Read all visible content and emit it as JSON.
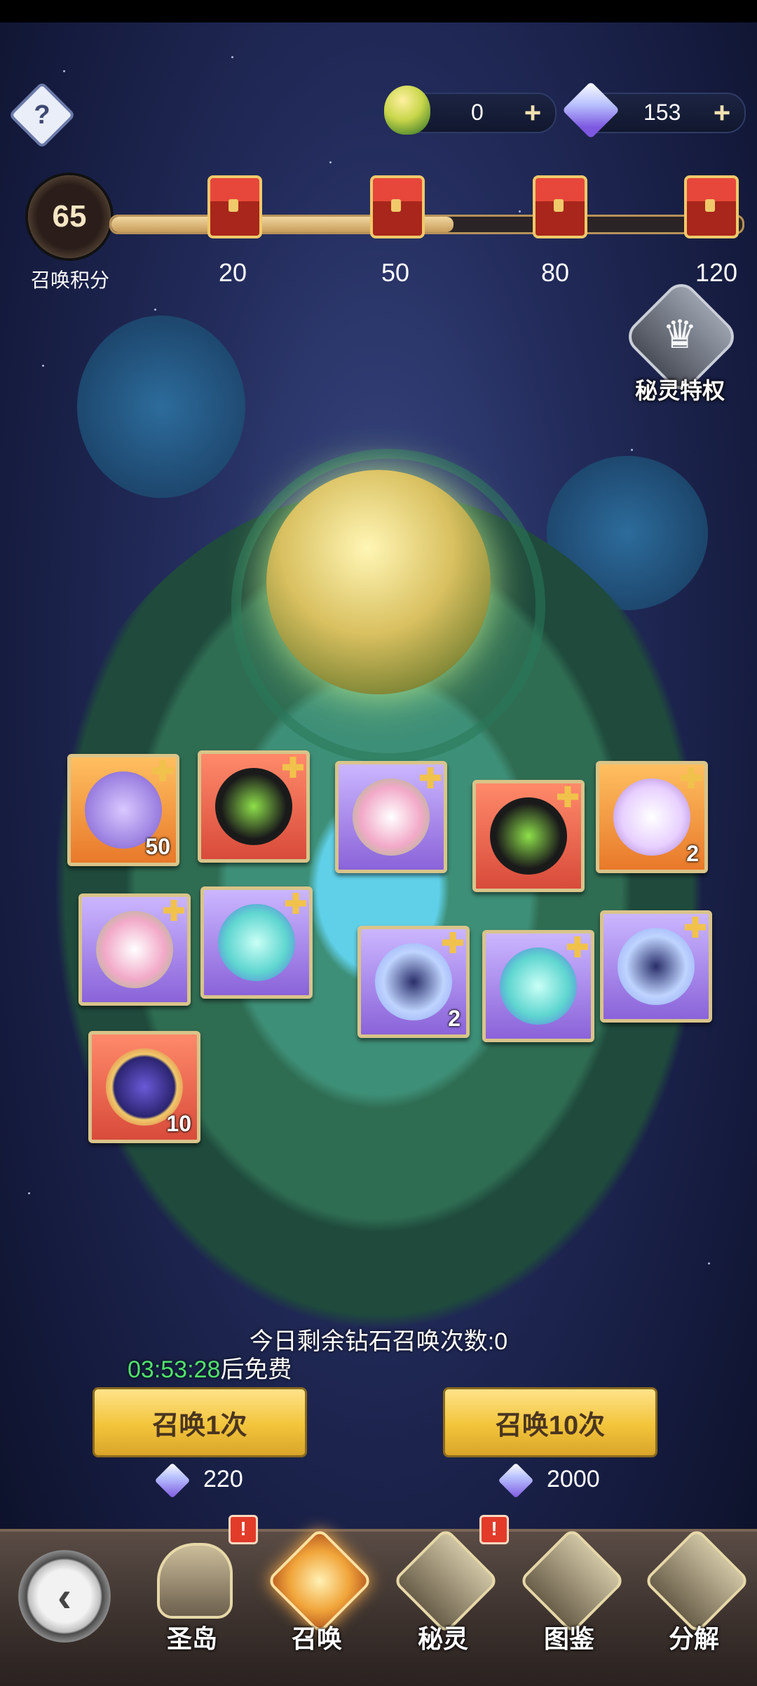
{
  "top_bar": {
    "help_icon": "help-icon",
    "currencies": [
      {
        "name": "leaf-token",
        "value": "0",
        "icon": "leaf-egg-icon"
      },
      {
        "name": "diamond",
        "value": "153",
        "icon": "diamond-icon"
      }
    ],
    "plus_label": "+"
  },
  "progress": {
    "current_score": "65",
    "score_label": "召唤积分",
    "current_value": 65,
    "milestones": [
      {
        "value": "20",
        "icon": "chest-icon"
      },
      {
        "value": "50",
        "icon": "chest-icon"
      },
      {
        "value": "80",
        "icon": "locked-chest-icon"
      },
      {
        "value": "120",
        "icon": "locked-chest-icon"
      }
    ]
  },
  "privilege": {
    "label": "秘灵特权",
    "icon": "crown-icon"
  },
  "rewards": [
    {
      "name": "dragon-unicorn",
      "count": "50",
      "rarity": "orange"
    },
    {
      "name": "dark-rabbit",
      "count": "",
      "rarity": "red"
    },
    {
      "name": "flower-sprite",
      "count": "",
      "rarity": "purple"
    },
    {
      "name": "dark-rabbit",
      "count": "",
      "rarity": "red"
    },
    {
      "name": "white-cat",
      "count": "2",
      "rarity": "orange"
    },
    {
      "name": "flower-sprite",
      "count": "",
      "rarity": "purple"
    },
    {
      "name": "ghost-deer",
      "count": "",
      "rarity": "purple"
    },
    {
      "name": "cloud-bunny",
      "count": "2",
      "rarity": "purple"
    },
    {
      "name": "ghost-deer",
      "count": "",
      "rarity": "purple"
    },
    {
      "name": "cloud-bunny",
      "count": "",
      "rarity": "purple"
    },
    {
      "name": "potion-bottle",
      "count": "10",
      "rarity": "red"
    }
  ],
  "summon": {
    "remaining_text": "今日剩余钻石召唤次数:0",
    "timer": "03:53:28",
    "timer_suffix": "后免费",
    "single": {
      "label": "召唤1次",
      "cost": "220"
    },
    "ten": {
      "label": "召唤10次",
      "cost": "2000"
    }
  },
  "nav": {
    "back_icon": "back-icon",
    "items": [
      {
        "label": "圣岛",
        "icon": "whale-icon",
        "badge": "!"
      },
      {
        "label": "召唤",
        "icon": "summon-icon",
        "active": true
      },
      {
        "label": "秘灵",
        "icon": "spirit-icon",
        "badge": "!"
      },
      {
        "label": "图鉴",
        "icon": "codex-icon"
      },
      {
        "label": "分解",
        "icon": "decompose-icon"
      }
    ]
  },
  "colors": {
    "accent_gold": "#f2c43a",
    "timer_green": "#4fe36b",
    "badge_red": "#e23b2a"
  }
}
